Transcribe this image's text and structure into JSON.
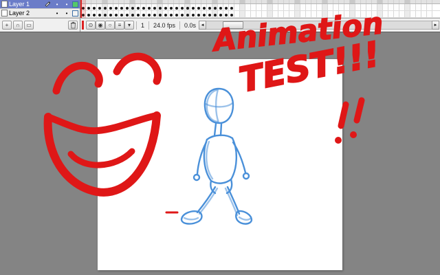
{
  "colors": {
    "selection": "#6b7cc8",
    "stage_gray": "#848484",
    "marker_red": "#df1717",
    "sketch_blue": "#4a90d9"
  },
  "timeline": {
    "layers": [
      {
        "name": "Layer 1",
        "selected": true,
        "pencil": "yes",
        "visible_dot": "•",
        "lock_dot": "•",
        "swatch": "#55c86a"
      },
      {
        "name": "Layer 2",
        "selected": false,
        "pencil": "",
        "visible_dot": "•",
        "lock_dot": "•",
        "swatch": "#f4f4f4"
      }
    ],
    "frames": {
      "keyframe_count": 28,
      "total_cells": 64
    },
    "buttons": {
      "insert_layer": "+",
      "motion_guide": "∩",
      "insert_folder": "▭",
      "center_frame": "⊙",
      "onion_skin": "◉",
      "onion_outlines": "○",
      "edit_multiple": "≡",
      "modify_markers": "▾",
      "scroll_left": "◄",
      "scroll_right": "►"
    },
    "status": {
      "current_frame": "1",
      "frame_rate": "24.0 fps",
      "elapsed_time": "0.0s"
    }
  },
  "drawings": {
    "headline_line1": "Animation",
    "headline_line2": "TEST!!!"
  }
}
